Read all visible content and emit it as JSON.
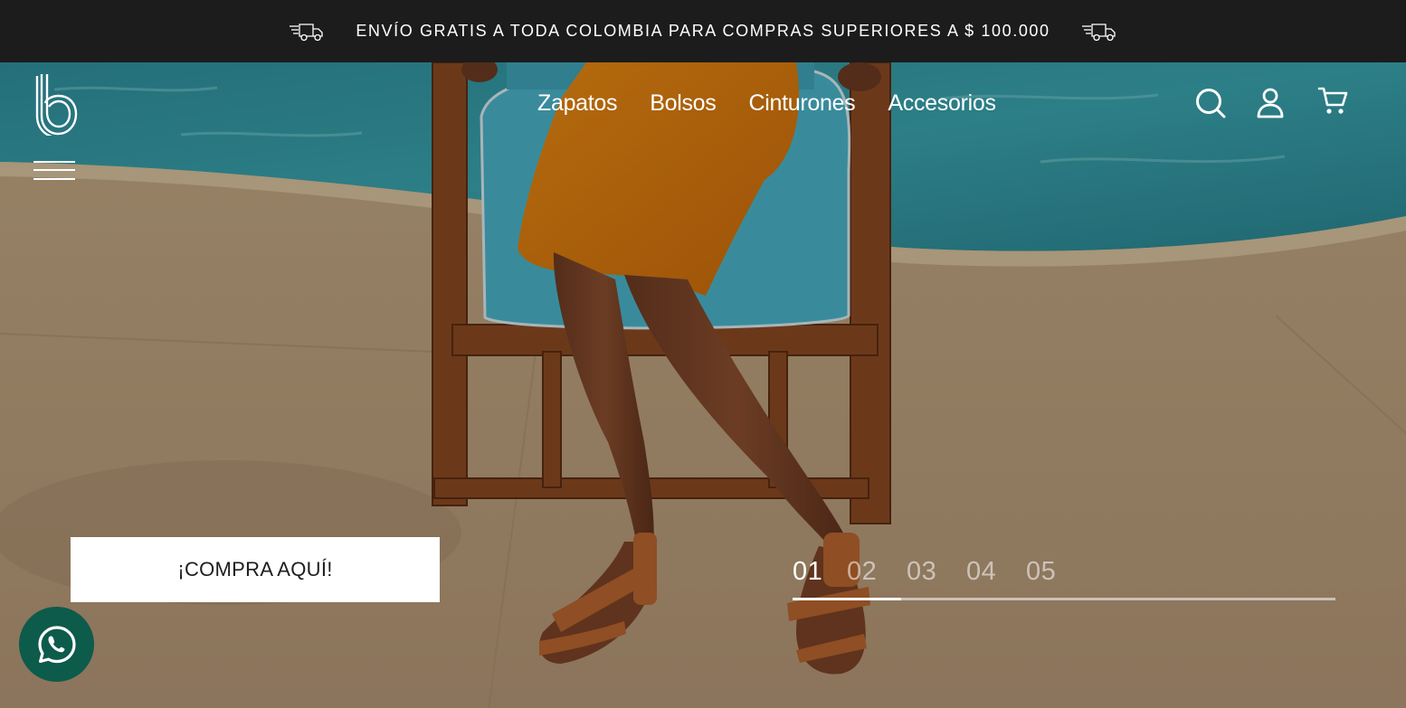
{
  "announcement": {
    "text": "ENVÍO GRATIS A TODA COLOMBIA PARA COMPRAS SUPERIORES A $ 100.000",
    "left_icon": "delivery-truck-icon",
    "right_icon": "delivery-truck-icon"
  },
  "header": {
    "logo_icon": "brand-b-logo",
    "menu_icon": "hamburger-menu-icon",
    "nav": [
      {
        "label": "Zapatos"
      },
      {
        "label": "Bolsos"
      },
      {
        "label": "Cinturones"
      },
      {
        "label": "Accesorios"
      }
    ],
    "actions": [
      {
        "icon": "search-icon"
      },
      {
        "icon": "user-account-icon"
      },
      {
        "icon": "shopping-cart-icon"
      }
    ]
  },
  "hero": {
    "cta_label": "¡COMPRA AQUÍ!",
    "slides": [
      "01",
      "02",
      "03",
      "04",
      "05"
    ],
    "active_slide_index": 0,
    "slide_progress": 0.2
  },
  "whatsapp": {
    "icon": "whatsapp-icon"
  },
  "colors": {
    "announcement_bg": "#1c1c1c",
    "cta_bg": "#ffffff",
    "whatsapp_bg": "#0d5b4b",
    "text_light": "#ffffff"
  }
}
